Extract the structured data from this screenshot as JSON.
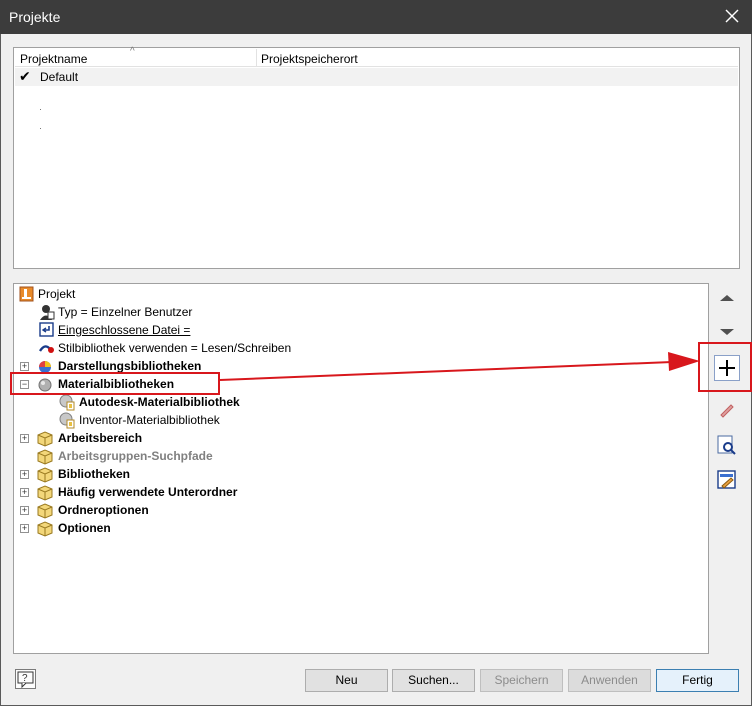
{
  "window": {
    "title": "Projekte"
  },
  "project_list": {
    "columns": [
      "Projektname",
      "Projektspeicherort"
    ],
    "rows": [
      {
        "name": "Default",
        "location": "",
        "active": true
      }
    ]
  },
  "tree": {
    "root": "Projekt",
    "items": [
      {
        "label": "Typ = Einzelner Benutzer",
        "icon": "user-icon"
      },
      {
        "label": "Eingeschlossene Datei =",
        "icon": "included-file-icon"
      },
      {
        "label": "Stilbibliothek verwenden = Lesen/Schreiben",
        "icon": "style-library-icon"
      },
      {
        "label": "Darstellungsbibliotheken",
        "icon": "appearance-library-icon",
        "expanded": false
      },
      {
        "label": "Materialbibliotheken",
        "icon": "material-library-icon",
        "expanded": true
      },
      {
        "label": "Autodesk-Materialbibliothek",
        "icon": "library-file-icon"
      },
      {
        "label": "Inventor-Materialbibliothek",
        "icon": "library-file-icon"
      },
      {
        "label": "Arbeitsbereich",
        "icon": "folder-icon",
        "expanded": false
      },
      {
        "label": "Arbeitsgruppen-Suchpfade",
        "icon": "folder-icon"
      },
      {
        "label": "Bibliotheken",
        "icon": "folder-icon",
        "expanded": false
      },
      {
        "label": "Häufig verwendete Unterordner",
        "icon": "folder-icon",
        "expanded": false
      },
      {
        "label": "Ordneroptionen",
        "icon": "folder-icon",
        "expanded": false
      },
      {
        "label": "Optionen",
        "icon": "folder-icon",
        "expanded": false
      }
    ]
  },
  "side_buttons": [
    "move-up-icon",
    "move-down-icon",
    "add-icon",
    "edit-icon",
    "find-icon",
    "edit-config-icon"
  ],
  "buttons": {
    "new": "Neu",
    "search": "Suchen...",
    "save": "Speichern",
    "apply": "Anwenden",
    "done": "Fertig"
  },
  "colors": {
    "titlebar": "#3c3c3c",
    "annotation": "#d8171c"
  }
}
